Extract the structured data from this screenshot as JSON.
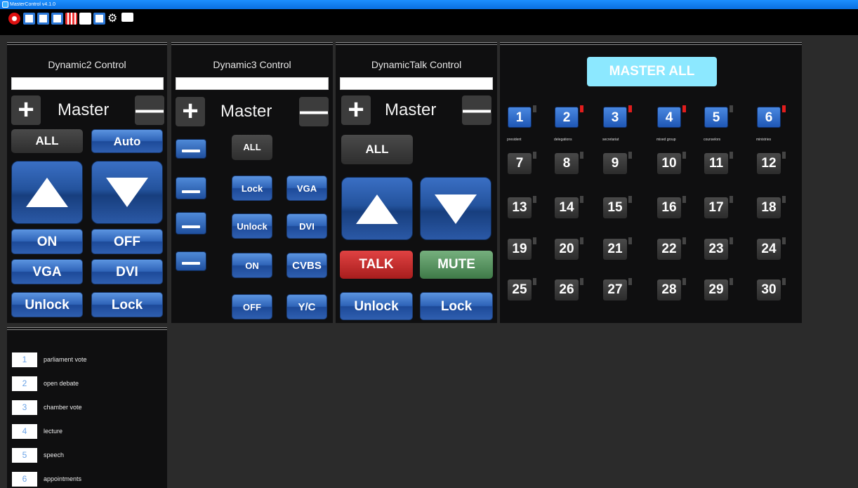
{
  "window": {
    "title": "MasterControl v4.1.0"
  },
  "toolbar": {
    "icons": [
      "stop-icon",
      "save-icon",
      "save-as-icon",
      "v-icon",
      "grid-icon",
      "blank-icon",
      "card-icon",
      "settings-icon",
      "chat-icon"
    ]
  },
  "dynamic2": {
    "title": "Dynamic2 Control",
    "master_label": "Master",
    "plus": "+",
    "minus": "—",
    "all": "ALL",
    "auto": "Auto",
    "on": "ON",
    "off": "OFF",
    "vga": "VGA",
    "dvi": "DVI",
    "unlock": "Unlock",
    "lock": "Lock"
  },
  "dynamic3": {
    "title": "Dynamic3 Control",
    "master_label": "Master",
    "plus": "+",
    "minus": "—",
    "all": "ALL",
    "lock": "Lock",
    "vga": "VGA",
    "unlock": "Unlock",
    "dvi": "DVI",
    "on": "ON",
    "cvbs": "CVBS",
    "off": "OFF",
    "yc": "Y/C"
  },
  "dynamictalk": {
    "title": "DynamicTalk Control",
    "master_label": "Master",
    "plus": "+",
    "minus": "—",
    "all": "ALL",
    "talk": "TALK",
    "mute": "MUTE",
    "unlock": "Unlock",
    "lock": "Lock"
  },
  "seats_panel": {
    "master_all": "MASTER ALL",
    "seats": [
      {
        "n": "1",
        "on": true,
        "red": false,
        "cap": "president"
      },
      {
        "n": "2",
        "on": true,
        "red": true,
        "cap": "delegations"
      },
      {
        "n": "3",
        "on": true,
        "red": true,
        "cap": "secretariat"
      },
      {
        "n": "4",
        "on": true,
        "red": true,
        "cap": "mixed group"
      },
      {
        "n": "5",
        "on": true,
        "red": false,
        "cap": "counselors"
      },
      {
        "n": "6",
        "on": true,
        "red": true,
        "cap": "ministries"
      },
      {
        "n": "7"
      },
      {
        "n": "8"
      },
      {
        "n": "9"
      },
      {
        "n": "10"
      },
      {
        "n": "11"
      },
      {
        "n": "12"
      },
      {
        "n": "13"
      },
      {
        "n": "14"
      },
      {
        "n": "15"
      },
      {
        "n": "16"
      },
      {
        "n": "17"
      },
      {
        "n": "18"
      },
      {
        "n": "19"
      },
      {
        "n": "20"
      },
      {
        "n": "21"
      },
      {
        "n": "22"
      },
      {
        "n": "23"
      },
      {
        "n": "24"
      },
      {
        "n": "25"
      },
      {
        "n": "26"
      },
      {
        "n": "27"
      },
      {
        "n": "28"
      },
      {
        "n": "29"
      },
      {
        "n": "30"
      }
    ]
  },
  "presets": [
    {
      "n": "1",
      "label": "parliament vote"
    },
    {
      "n": "2",
      "label": "open debate"
    },
    {
      "n": "3",
      "label": "chamber vote"
    },
    {
      "n": "4",
      "label": "lecture"
    },
    {
      "n": "5",
      "label": "speech"
    },
    {
      "n": "6",
      "label": "appointments"
    }
  ],
  "colors": {
    "accent_blue": "#2f64b8",
    "talk_red": "#c62f2f",
    "mute_green": "#5a9463",
    "master_all": "#8ce8ff"
  }
}
